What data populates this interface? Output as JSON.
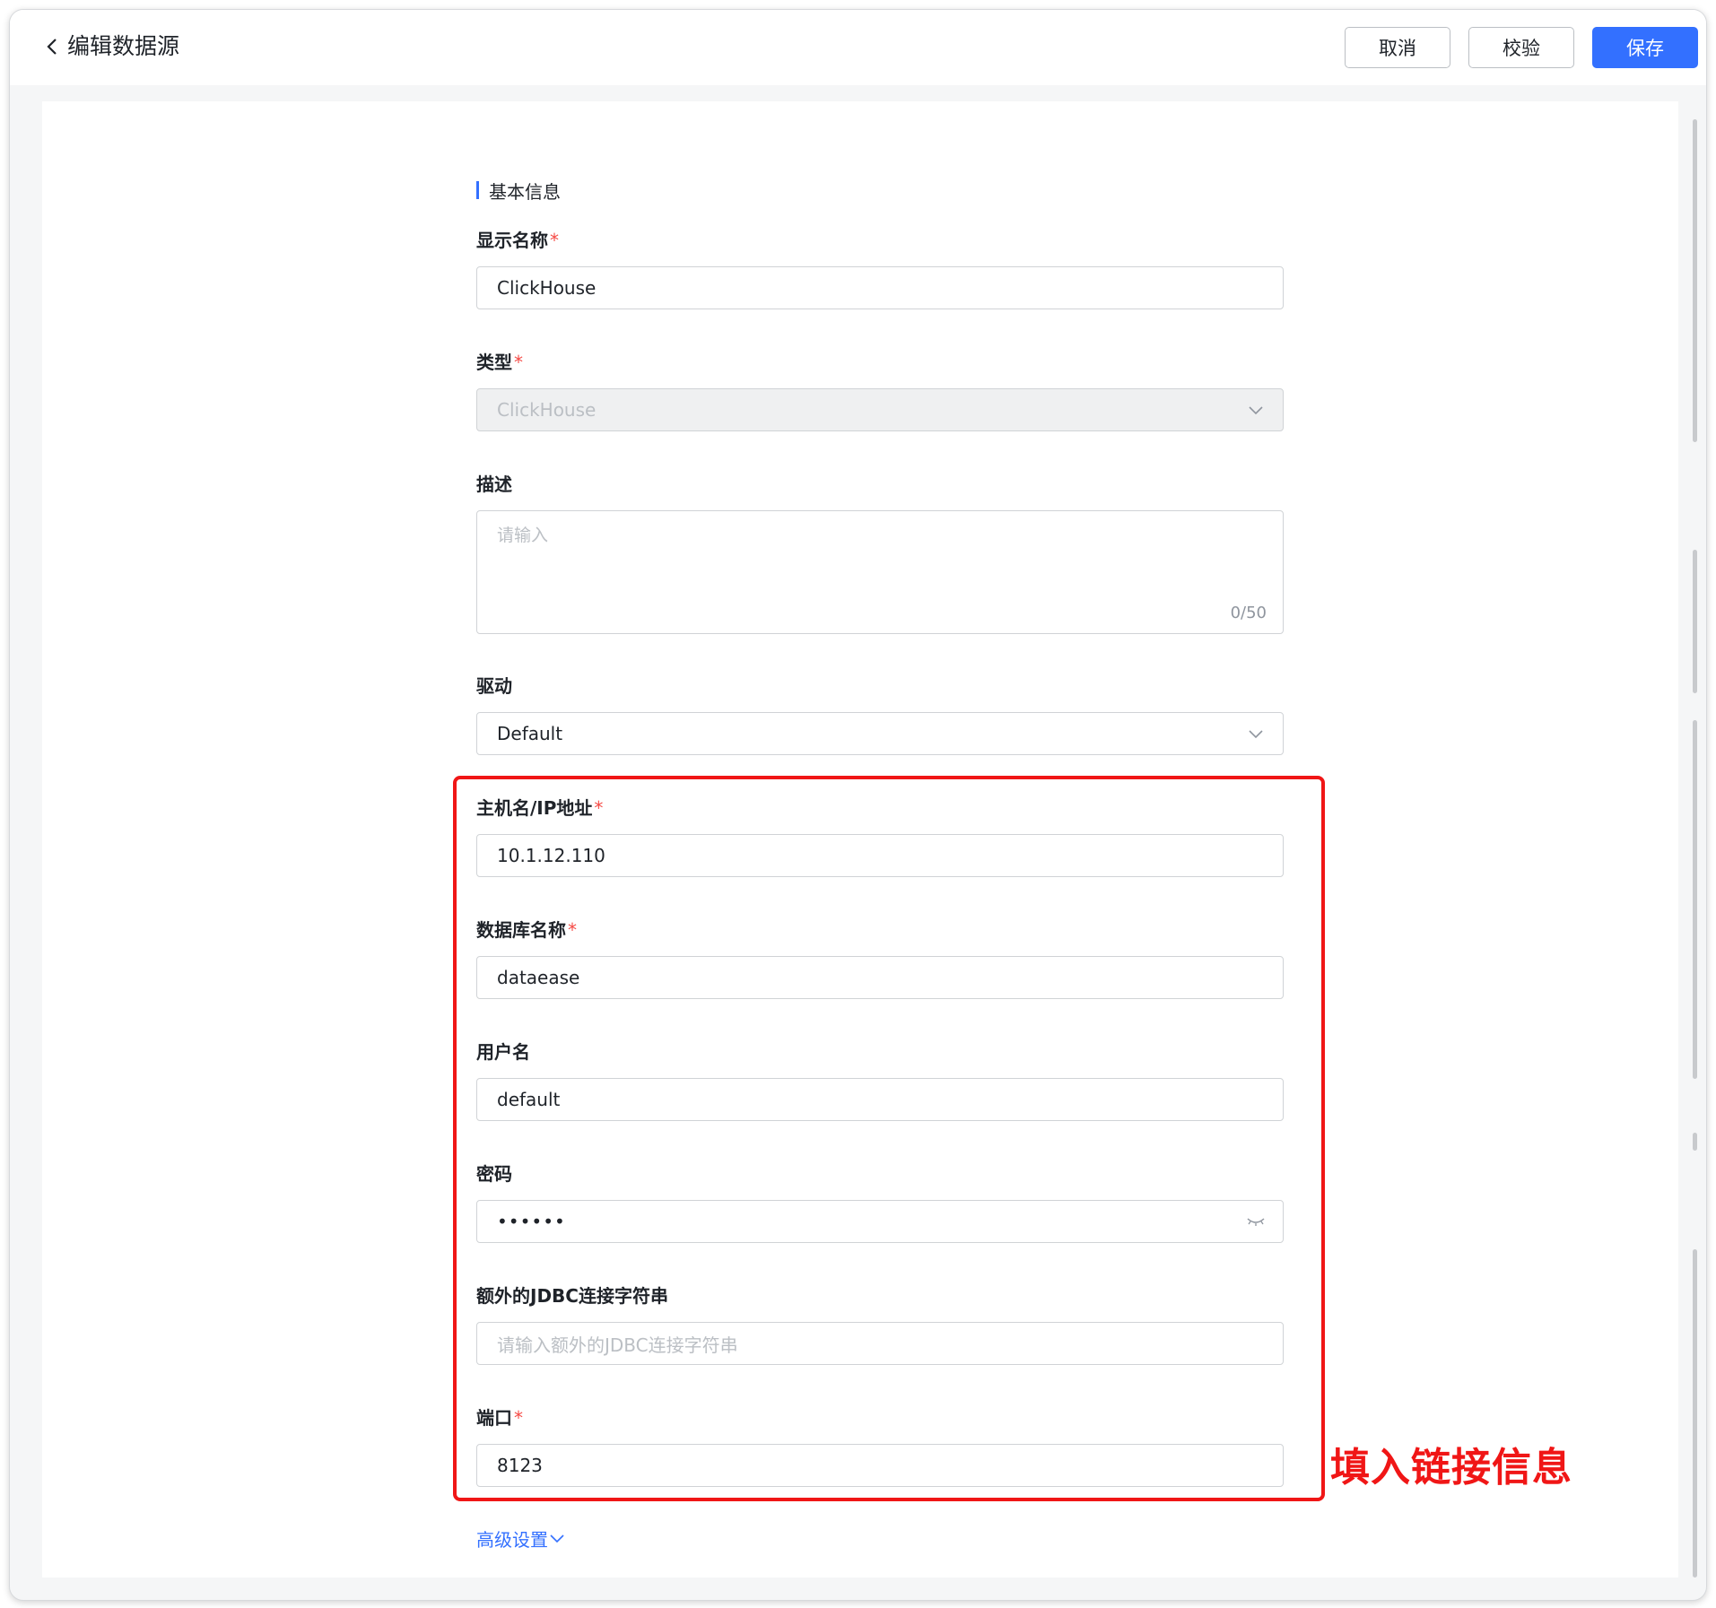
{
  "header": {
    "title": "编辑数据源",
    "cancel_label": "取消",
    "validate_label": "校验",
    "save_label": "保存"
  },
  "form": {
    "section_title": "基本信息",
    "display_name": {
      "label": "显示名称",
      "value": "ClickHouse",
      "required": true
    },
    "type": {
      "label": "类型",
      "value": "ClickHouse",
      "required": true,
      "disabled": true
    },
    "description": {
      "label": "描述",
      "placeholder": "请输入",
      "counter": "0/50"
    },
    "driver": {
      "label": "驱动",
      "value": "Default"
    },
    "host": {
      "label": "主机名/IP地址",
      "value": "10.1.12.110",
      "required": true
    },
    "database": {
      "label": "数据库名称",
      "value": "dataease",
      "required": true
    },
    "username": {
      "label": "用户名",
      "value": "default"
    },
    "password": {
      "label": "密码",
      "masked_value": "••••••"
    },
    "jdbc_extra": {
      "label": "额外的JDBC连接字符串",
      "placeholder": "请输入额外的JDBC连接字符串"
    },
    "port": {
      "label": "端口",
      "value": "8123",
      "required": true
    },
    "advanced_label": "高级设置"
  },
  "annotation": {
    "text": "填入链接信息",
    "color": "#f01616"
  },
  "colors": {
    "primary": "#3370ff",
    "required_star": "#f54a45",
    "highlight_box": "#f01616"
  },
  "icons": {
    "back": "chevron-left-icon",
    "dropdown": "chevron-down-icon",
    "password_toggle": "eye-closed-icon",
    "advanced": "chevron-down-icon"
  }
}
